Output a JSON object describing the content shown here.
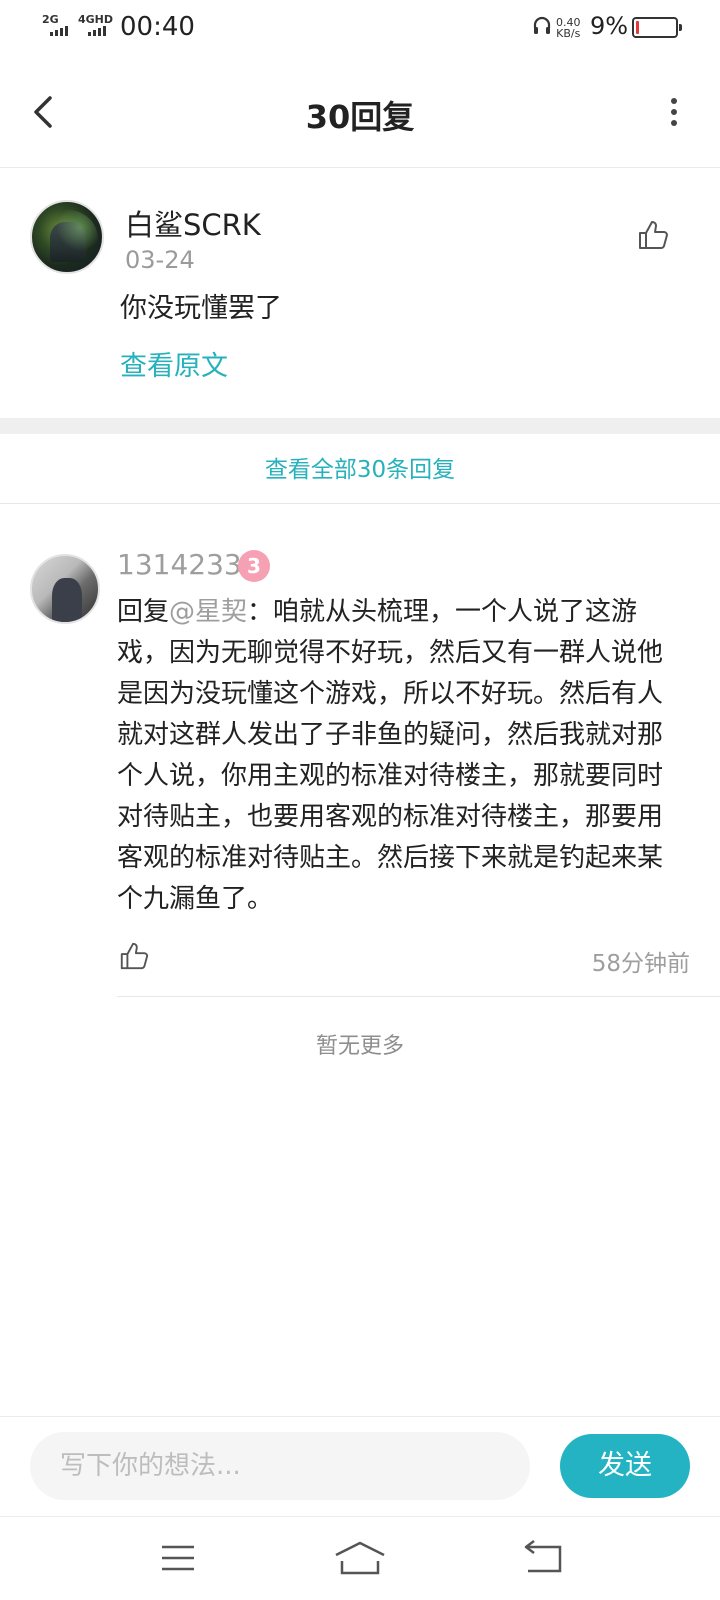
{
  "status_bar": {
    "signal_1": "2G",
    "signal_2": "4GHD",
    "time": "00:40",
    "net_speed_value": "0.40",
    "net_speed_unit": "KB/s",
    "battery_percent": "9%",
    "battery_level": 0.09,
    "battery_color": "#e53935"
  },
  "header": {
    "title": "30回复",
    "back_icon": "chevron-left-icon",
    "more_icon": "more-vertical-icon"
  },
  "post": {
    "author": "白鲨SCRK",
    "date": "03-24",
    "text": "你没玩懂罢了",
    "view_original": "查看原文",
    "like_icon": "thumbs-up-icon"
  },
  "view_all_replies": "查看全部30条回复",
  "reply": {
    "author": "1314233",
    "level": "3",
    "reply_prefix": "回复",
    "mention": "@星契",
    "content": "：咱就从头梳理，一个人说了这游戏，因为无聊觉得不好玩，然后又有一群人说他是因为没玩懂这个游戏，所以不好玩。然后有人就对这群人发出了子非鱼的疑问，然后我就对那个人说，你用主观的标准对待楼主，那就要同时对待贴主，也要用客观的标准对待楼主，那要用客观的标准对待贴主。然后接下来就是钓起来某个九漏鱼了。",
    "time": "58分钟前",
    "like_icon": "thumbs-up-icon"
  },
  "no_more": "暂无更多",
  "composer": {
    "placeholder": "写下你的想法...",
    "send_label": "发送"
  },
  "colors": {
    "accent": "#27b1bd",
    "send_button": "#23b3c2",
    "level_badge": "#f6a0b4"
  },
  "nav": {
    "menu_icon": "menu-icon",
    "home_icon": "home-icon",
    "back_icon": "back-arrow-icon"
  }
}
